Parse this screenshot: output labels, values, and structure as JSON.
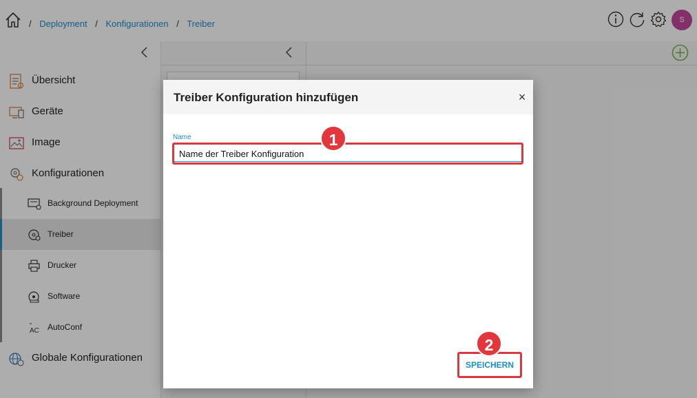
{
  "breadcrumb": {
    "items": [
      {
        "label": "Deployment"
      },
      {
        "label": "Konfigurationen"
      },
      {
        "label": "Treiber"
      }
    ],
    "separator": "/"
  },
  "header": {
    "avatar_initial": "S",
    "avatar_color": "#c2479d",
    "icons": [
      "home-icon",
      "info-icon",
      "refresh-icon",
      "settings-icon"
    ]
  },
  "sidebar": {
    "items": [
      {
        "label": "Übersicht",
        "icon": "overview-icon"
      },
      {
        "label": "Geräte",
        "icon": "devices-icon"
      },
      {
        "label": "Image",
        "icon": "image-icon"
      },
      {
        "label": "Konfigurationen",
        "icon": "configurations-icon"
      }
    ],
    "sub_items": [
      {
        "label": "Background Deployment",
        "icon": "background-deployment-icon"
      },
      {
        "label": "Treiber",
        "icon": "driver-icon",
        "active": true
      },
      {
        "label": "Drucker",
        "icon": "printer-icon"
      },
      {
        "label": "Software",
        "icon": "software-icon"
      },
      {
        "label": "AutoConf",
        "icon": "autoconf-icon"
      }
    ],
    "bottom_item": {
      "label": "Globale Konfigurationen",
      "icon": "global-configurations-icon"
    }
  },
  "modal": {
    "title": "Treiber Konfiguration hinzufügen",
    "close_symbol": "×",
    "field_label": "Name",
    "field_value": "Name der Treiber Konfiguration",
    "save_label": "SPEICHERN"
  },
  "annotations": {
    "step1": "1",
    "step2": "2"
  },
  "colors": {
    "accent": "#1c8dc7",
    "highlight": "#d63a40",
    "add_button": "#7ab648"
  }
}
